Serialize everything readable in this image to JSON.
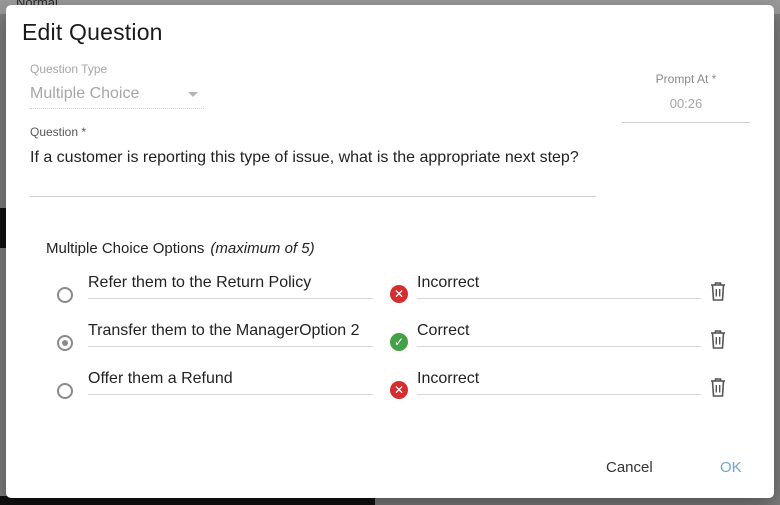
{
  "background": {
    "toolbar_style": "Normal"
  },
  "dialog": {
    "title": "Edit Question",
    "question_type": {
      "label": "Question Type",
      "value": "Multiple Choice"
    },
    "prompt_at": {
      "label": "Prompt At *",
      "value": "00:26"
    },
    "question": {
      "label": "Question *",
      "value": "If a customer is reporting this type of issue, what is the appropriate next step?"
    },
    "mc_options": {
      "header": "Multiple Choice Options",
      "hint": "(maximum of 5)",
      "items": [
        {
          "text": "Refer them to the Return Policy",
          "selected": false,
          "status": "Incorrect",
          "status_icon": "x-circle-icon"
        },
        {
          "text": "Transfer them to the ManagerOption 2",
          "selected": true,
          "status": "Correct",
          "status_icon": "check-circle-icon"
        },
        {
          "text": "Offer them a Refund",
          "selected": false,
          "status": "Incorrect",
          "status_icon": "x-circle-icon"
        }
      ]
    },
    "actions": {
      "cancel": "Cancel",
      "ok": "OK"
    }
  },
  "colors": {
    "incorrect": "#d32f2f",
    "correct": "#43a047",
    "ok_accent": "#6ea8c9"
  }
}
